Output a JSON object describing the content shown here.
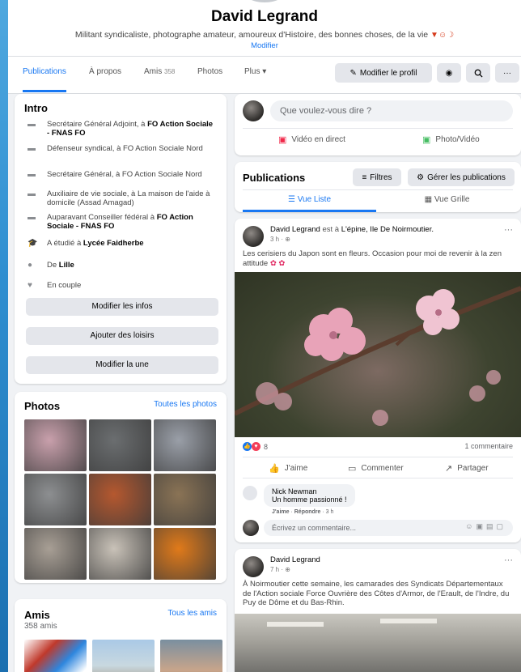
{
  "profile": {
    "name": "David Legrand",
    "bio": "Militant syndicaliste, photographe amateur, amoureux d'Histoire, des bonnes choses, de la vie",
    "bio_emojis": "▼☺☽",
    "edit_link": "Modifier"
  },
  "tabs": {
    "items": [
      {
        "label": "Publications"
      },
      {
        "label": "À propos"
      },
      {
        "label": "Amis",
        "count": "358"
      },
      {
        "label": "Photos"
      },
      {
        "label": "Plus ▾"
      }
    ],
    "edit_profile": "Modifier le profil"
  },
  "intro": {
    "title": "Intro",
    "items": [
      {
        "pre": "Secrétaire Général Adjoint, à ",
        "bold": "FO Action Sociale - FNAS FO",
        "icon": "briefcase-icon"
      },
      {
        "pre": "Défenseur syndical, à FO Action Sociale Nord",
        "bold": "",
        "icon": "briefcase-icon"
      },
      {
        "pre": "Secrétaire Général, à FO Action Sociale Nord",
        "bold": "",
        "icon": "briefcase-icon"
      },
      {
        "pre": "Auxiliaire de vie sociale, à La maison de l'aide à domicile (Assad Amagad)",
        "bold": "",
        "icon": "briefcase-icon"
      },
      {
        "pre": "Auparavant Conseiller fédéral à ",
        "bold": "FO Action Sociale - FNAS FO",
        "icon": "briefcase-icon"
      },
      {
        "pre": "A étudié à ",
        "bold": "Lycée Faidherbe",
        "icon": "graduation-icon"
      },
      {
        "pre": "De ",
        "bold": "Lille",
        "icon": "location-icon"
      },
      {
        "pre": "En couple",
        "bold": "",
        "icon": "heart-icon"
      }
    ],
    "buttons": [
      "Modifier les infos",
      "Ajouter des loisirs",
      "Modifier la une"
    ]
  },
  "photos": {
    "title": "Photos",
    "link": "Toutes les photos",
    "grid_colors": [
      "#c9a0ac",
      "#6b6e70",
      "#9a9fa8",
      "#8d8f91",
      "#b5582f",
      "#8a7355",
      "#a89f95",
      "#c9c2b8",
      "#e07a1a"
    ]
  },
  "friends": {
    "title": "Amis",
    "count_label": "358 amis",
    "link": "Tous les amis"
  },
  "composer": {
    "placeholder": "Que voulez-vous dire ?",
    "live": "Vidéo en direct",
    "photo": "Photo/Vidéo"
  },
  "publications": {
    "title": "Publications",
    "filters": "Filtres",
    "manage": "Gérer les publications",
    "view_list": "Vue Liste",
    "view_grid": "Vue Grille"
  },
  "post1": {
    "author": "David Legrand",
    "location_prefix": "est à",
    "location": "L'épine, Ile De Noirmoutier.",
    "time": "3 h",
    "text": "Les cerisiers du Japon sont en fleurs. Occasion pour moi de revenir à la zen attitude",
    "reaction_count": "8",
    "comment_count": "1 commentaire",
    "like": "J'aime",
    "comment": "Commenter",
    "share": "Partager",
    "comment_author": "Nick Newman",
    "comment_text": "Un homme passionné !",
    "comment_like": "J'aime",
    "comment_reply": "Répondre",
    "comment_time": "3 h",
    "write_placeholder": "Écrivez un commentaire..."
  },
  "post2": {
    "author": "David Legrand",
    "time": "7 h",
    "text": "À Noirmoutier cette semaine, les camarades des Syndicats Départementaux de l'Action sociale Force Ouvrière des Côtes d'Armor, de l'Erault, de l'Indre, du Puy de Dôme et du Bas-Rhin."
  },
  "colors": {
    "accent": "#1877f2",
    "bg": "#f0f2f5",
    "live_red": "#f02849",
    "photo_green": "#45bd62"
  }
}
